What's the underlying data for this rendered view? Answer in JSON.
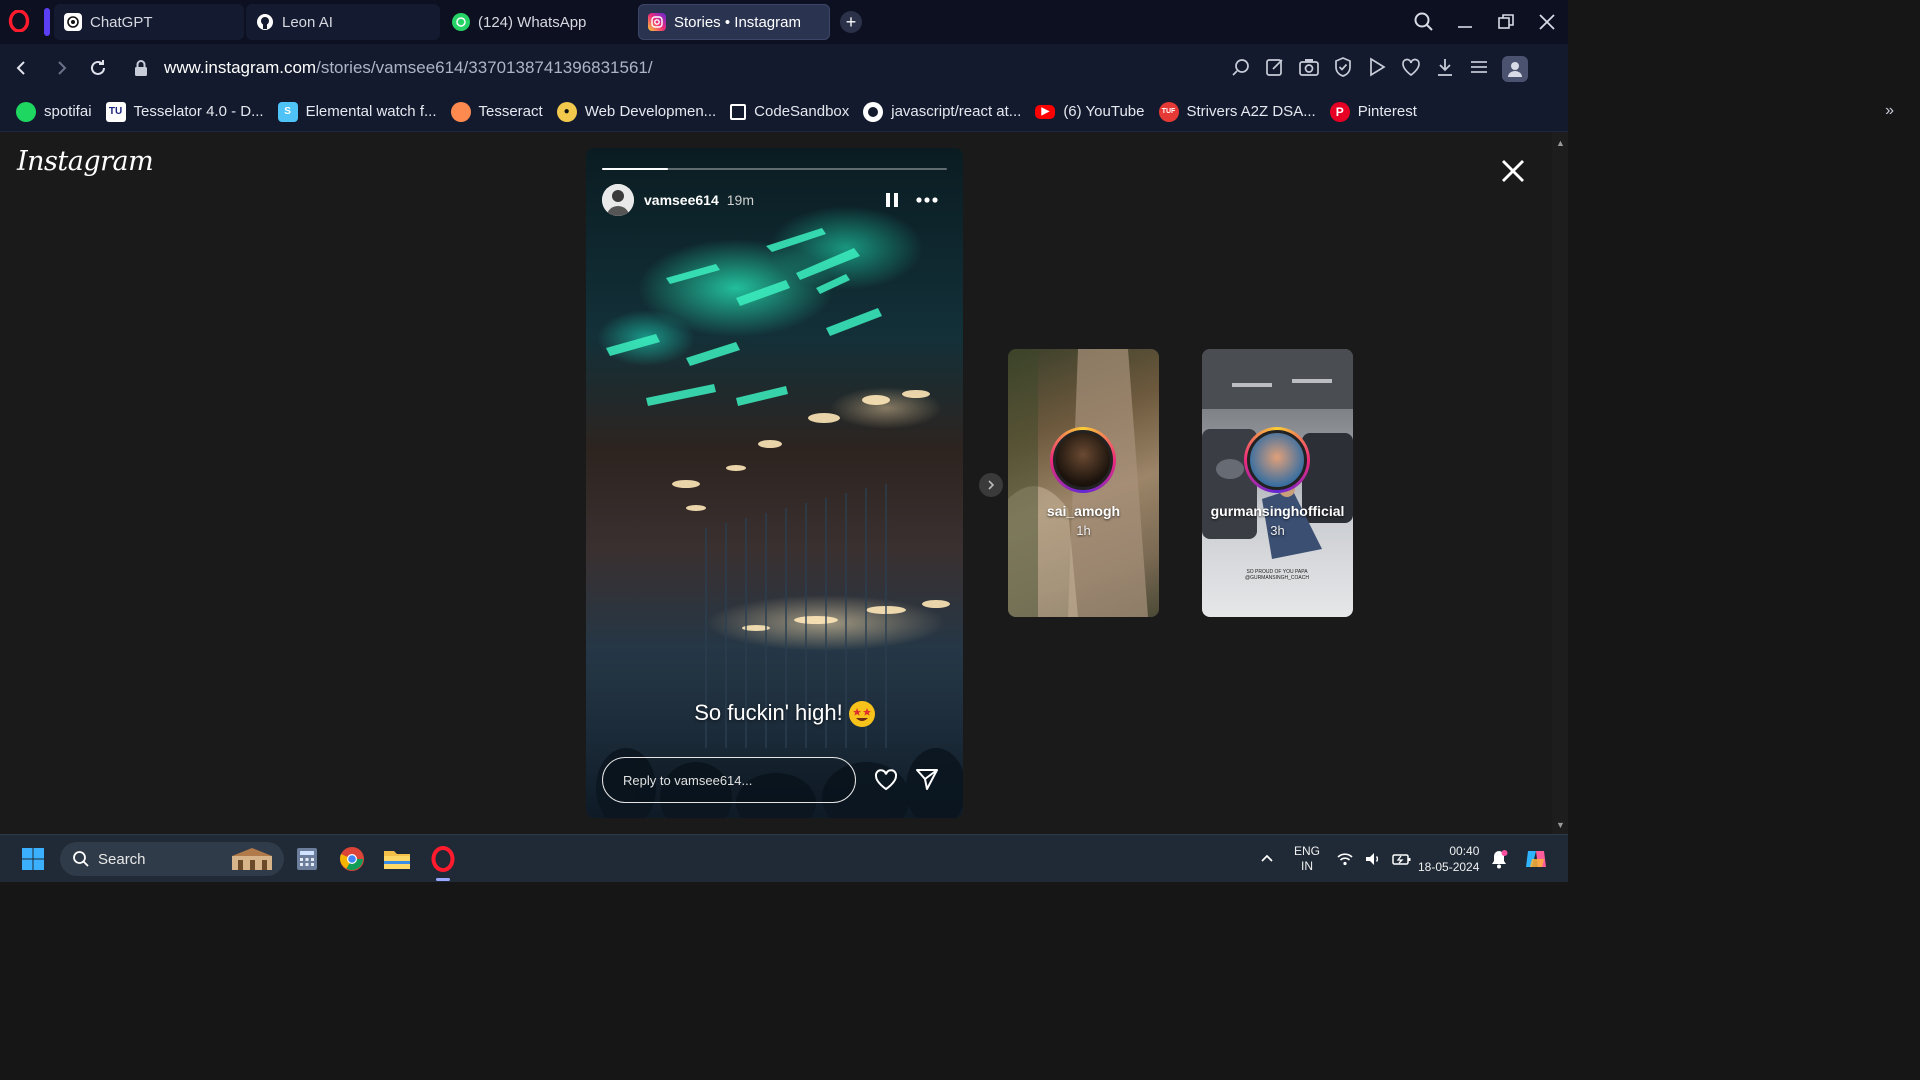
{
  "browser": {
    "tabs": [
      {
        "label": "ChatGPT",
        "active": false,
        "icon": "chatgpt-icon"
      },
      {
        "label": "Leon AI",
        "active": false,
        "icon": "github-icon"
      },
      {
        "label": "(124) WhatsApp",
        "active": false,
        "icon": "whatsapp-icon"
      },
      {
        "label": "Stories • Instagram",
        "active": true,
        "icon": "instagram-icon"
      }
    ],
    "url_domain": "www.instagram.com",
    "url_path": "/stories/vamsee614/3370138741396831561/",
    "bookmarks": [
      {
        "label": "spotifai",
        "icon": "spotify-icon",
        "color": "#1ed760"
      },
      {
        "label": "Tesselator 4.0 - D...",
        "icon": "tesselator-icon",
        "color": "#ffffff"
      },
      {
        "label": "Elemental watch f...",
        "icon": "elemental-icon",
        "color": "#4fc3f7"
      },
      {
        "label": "Tesseract",
        "icon": "tesseract-icon",
        "color": "#ff8a50"
      },
      {
        "label": "Web Developmen...",
        "icon": "webdev-icon",
        "color": "#f2c94c"
      },
      {
        "label": "CodeSandbox",
        "icon": "codesandbox-icon",
        "color": "#ffffff"
      },
      {
        "label": "javascript/react at...",
        "icon": "github-icon",
        "color": "#ffffff"
      },
      {
        "label": "(6) YouTube",
        "icon": "youtube-icon",
        "color": "#ff0000"
      },
      {
        "label": "Strivers A2Z DSA...",
        "icon": "tuf-icon",
        "color": "#e53935"
      },
      {
        "label": "Pinterest",
        "icon": "pinterest-icon",
        "color": "#e60023"
      }
    ]
  },
  "instagram": {
    "logo": "Instagram",
    "story": {
      "username": "vamsee614",
      "time": "19m",
      "progress": 0.19,
      "caption": "So fuckin' high!",
      "reply_placeholder": "Reply to vamsee614..."
    },
    "next_stories": [
      {
        "username": "sai_amogh",
        "time": "1h"
      },
      {
        "username": "gurmansinghofficial",
        "time": "3h",
        "caption": "SO PROUD OF YOU PAPA @GURMANSINGH_COACH"
      }
    ]
  },
  "taskbar": {
    "search_label": "Search",
    "lang_top": "ENG",
    "lang_bottom": "IN",
    "time": "00:40",
    "date": "18-05-2024"
  },
  "colors": {
    "accent": "#5b3ff5",
    "instagram_ring": "#ee2a7b",
    "story_bg": "#1a1a1a"
  }
}
